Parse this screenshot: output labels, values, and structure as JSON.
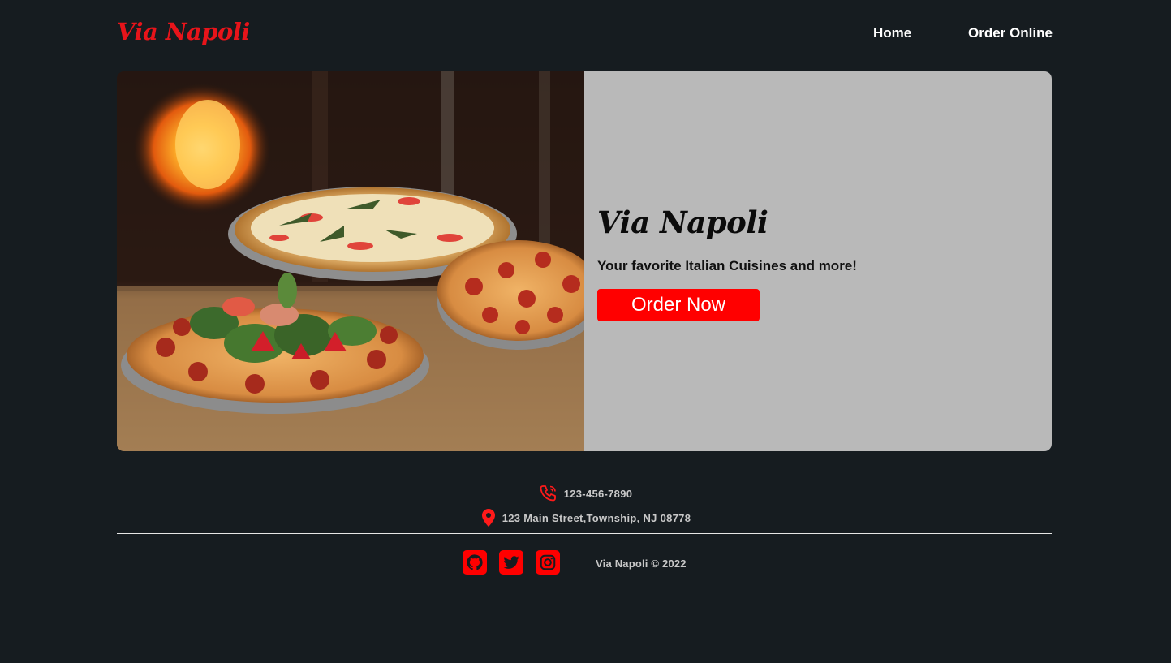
{
  "header": {
    "logo": "Via Napoli",
    "nav": [
      {
        "label": "Home"
      },
      {
        "label": "Order Online"
      }
    ]
  },
  "hero": {
    "image_icon": "pizza-photo",
    "title": "Via Napoli",
    "subtitle": "Your favorite Italian Cuisines and more!",
    "cta_label": "Order Now"
  },
  "contact": {
    "phone": "123-456-7890",
    "phone_icon": "phone-icon",
    "address": "123 Main Street,Township, NJ 08778",
    "address_icon": "location-pin-icon"
  },
  "footer": {
    "social": [
      {
        "icon": "github-icon"
      },
      {
        "icon": "twitter-icon"
      },
      {
        "icon": "instagram-icon"
      }
    ],
    "copyright": "Via Napoli © 2022"
  },
  "colors": {
    "background": "#161c20",
    "accent": "#ff0000",
    "logo": "#e8141a",
    "hero_panel": "#b9b9b9"
  }
}
